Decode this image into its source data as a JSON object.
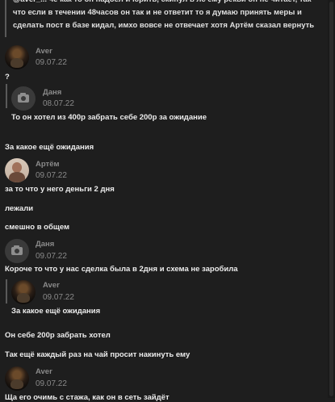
{
  "top_quote": {
    "lines": [
      "@aver_... чё как то он надоел и юрить, скинул в лс ему рекви он не читает, так",
      "что если в течении 48часов он так и не ответит то я думаю принять меры и",
      "сделать пост в базе кидал, имхо вовсе не отвечает хотя Артём сказал вернуть"
    ]
  },
  "messages": [
    {
      "author": "Aver",
      "date": "09.07.22",
      "text": "?"
    },
    {
      "author": "Даня",
      "date": "08.07.22",
      "text": "То он хотел из 400р забрать себе 200р за ожидание"
    },
    {
      "text": "За какое ещё ожидания"
    },
    {
      "author": "Артём",
      "date": "09.07.22",
      "text": "за то что у него деньги 2 дня"
    },
    {
      "text": "лежали"
    },
    {
      "text": "смешно в общем"
    },
    {
      "author": "Даня",
      "date": "09.07.22",
      "text": "Короче то что у нас сделка была в 2дня и схема не заробила"
    },
    {
      "author": "Aver",
      "date": "09.07.22",
      "text": "За какое ещё ожидания"
    },
    {
      "text": "Он себе 200р забрать хотел"
    },
    {
      "text": "Так ещё каждый раз на чай просит накинуть ему"
    },
    {
      "author": "Aver",
      "date": "09.07.22",
      "text": "Ща его очимь с стажа, как он в сеть зайдёт"
    }
  ]
}
